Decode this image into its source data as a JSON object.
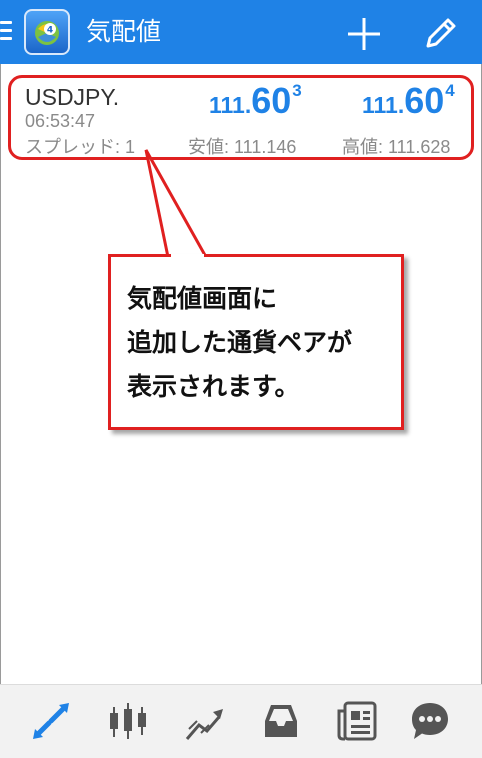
{
  "app_bar": {
    "title": "気配値",
    "icons": [
      "menu-icon",
      "mt4-logo-icon",
      "plus-icon",
      "pencil-icon"
    ],
    "background_color": "#1f82e6"
  },
  "quote": {
    "symbol": "USDJPY.",
    "time": "06:53:47",
    "spread": "スプレッド: 1",
    "bid": {
      "prefix": "111.",
      "big": "60",
      "sup": "3"
    },
    "ask": {
      "prefix": "111.",
      "big": "60",
      "sup": "4"
    },
    "low": "安値: 111.146",
    "high": "高値: 111.628",
    "price_color": "#1f82e6",
    "highlight_color": "#e02020"
  },
  "callout": {
    "lines": [
      "気配値画面に",
      "追加した通貨ペアが",
      "表示されます。"
    ],
    "border_color": "#e02020"
  },
  "bottom_nav": {
    "items": [
      "quotes-icon",
      "chart-icon",
      "trade-icon",
      "history-icon",
      "news-icon",
      "chat-icon"
    ],
    "active_index": 0,
    "active_color": "#1f82e6",
    "inactive_color": "#555555"
  }
}
